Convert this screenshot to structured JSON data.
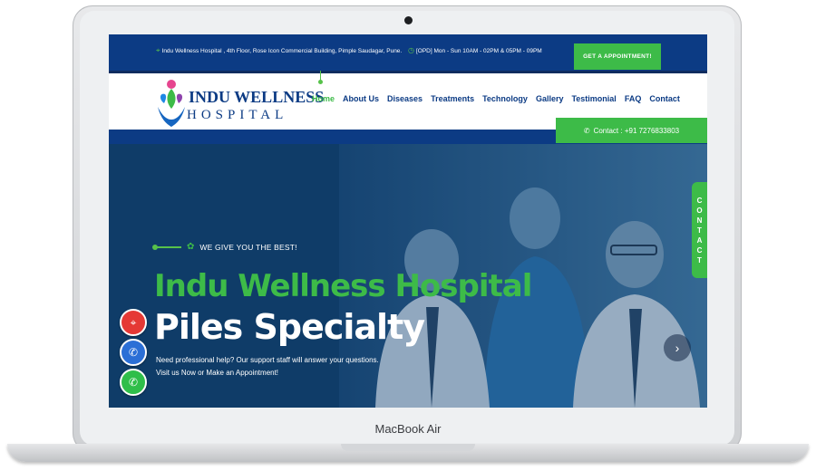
{
  "device": {
    "brand_label": "MacBook Air"
  },
  "topbar": {
    "address": "Indu Wellness Hospital , 4th Floor, Rose Icon Commercial Building, Pimple Saudagar, Pune.",
    "hours": "[OPD] Mon - Sun 10AM - 02PM & 05PM - 09PM",
    "appointment_label": "GET A APPOINTMENT!"
  },
  "logo": {
    "line1": "INDU WELLNESS",
    "line2": "HOSPITAL"
  },
  "nav": {
    "items": [
      {
        "label": "Home",
        "active": true
      },
      {
        "label": "About Us"
      },
      {
        "label": "Diseases"
      },
      {
        "label": "Treatments"
      },
      {
        "label": "Technology"
      },
      {
        "label": "Gallery"
      },
      {
        "label": "Testimonial"
      },
      {
        "label": "FAQ"
      },
      {
        "label": "Contact"
      }
    ],
    "contact_label": "Contact : +91 7276833803"
  },
  "hero": {
    "tagline": "WE GIVE YOU THE BEST!",
    "title": "Indu Wellness Hospital",
    "subtitle": "Piles Specialty",
    "description_line1": "Need professional help? Our support staff will answer your questions.",
    "description_line2": "Visit us Now or Make an Appointment!",
    "next_glyph": "›"
  },
  "side_tab": {
    "label": "CONTACT"
  },
  "floating": [
    {
      "name": "location-icon",
      "color": "#e53935"
    },
    {
      "name": "phone-icon",
      "color": "#2b6fd6"
    },
    {
      "name": "whatsapp-icon",
      "color": "#2fbe4a"
    }
  ],
  "colors": {
    "navy": "#0c3b84",
    "green": "#3dbb48"
  }
}
